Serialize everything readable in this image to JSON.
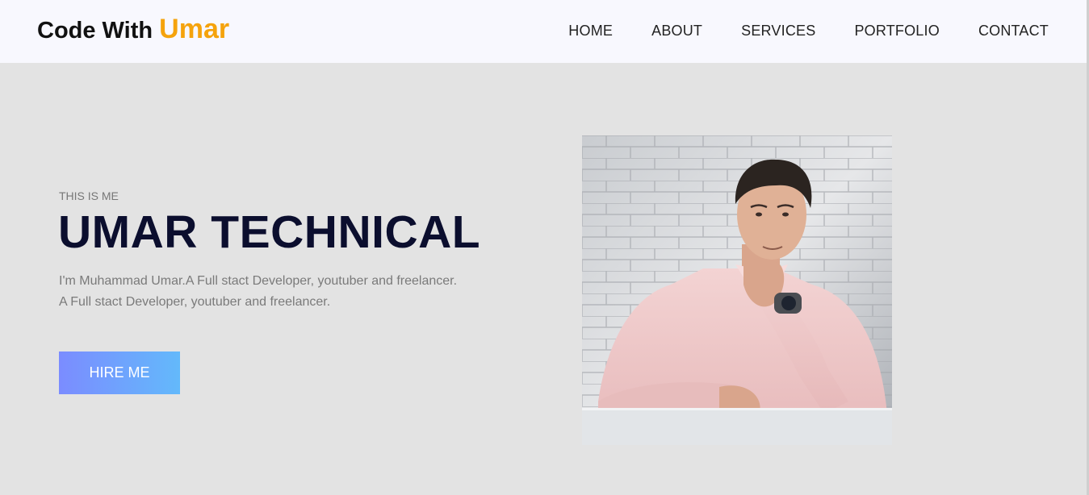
{
  "header": {
    "logo_main": "Code With ",
    "logo_accent": "Umar",
    "nav": [
      "HOME",
      "ABOUT",
      "SERVICES",
      "PORTFOLIO",
      "CONTACT"
    ]
  },
  "hero": {
    "subtitle": "THIS IS ME",
    "title": "UMAR TECHNICAL",
    "description_line1": "I'm Muhammad Umar.A Full stact Developer, youtuber and freelancer.",
    "description_line2": "A Full stact Developer, youtuber and freelancer.",
    "button_label": "HIRE ME"
  },
  "colors": {
    "accent": "#f5a30c",
    "title": "#0b0e2e",
    "button_gradient_start": "#7b8cff",
    "button_gradient_end": "#63b9fb"
  }
}
